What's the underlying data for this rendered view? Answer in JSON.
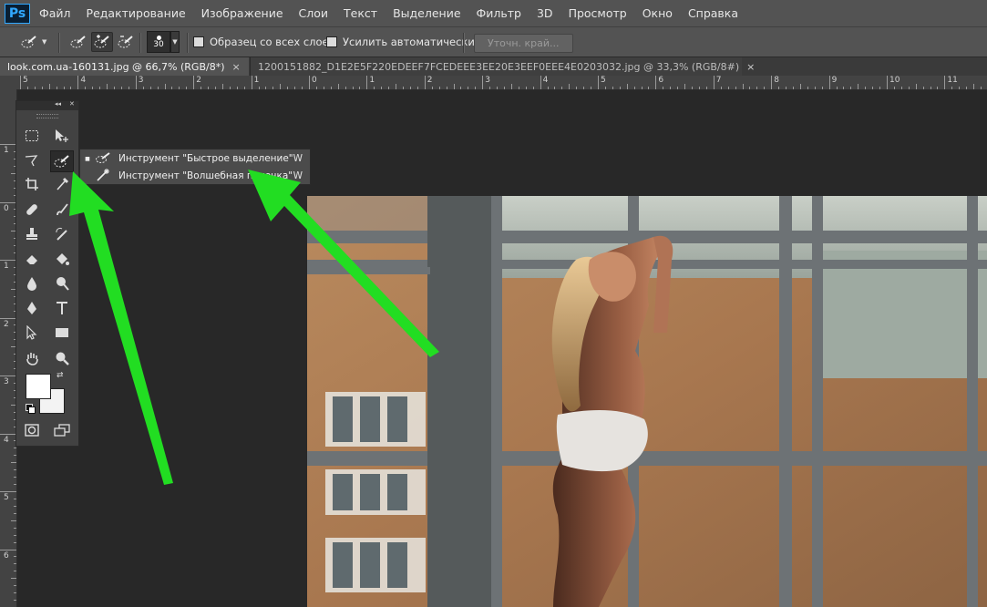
{
  "app": {
    "logo": "Ps"
  },
  "menu": [
    "Файл",
    "Редактирование",
    "Изображение",
    "Слои",
    "Текст",
    "Выделение",
    "Фильтр",
    "3D",
    "Просмотр",
    "Окно",
    "Справка"
  ],
  "options": {
    "brush_size": "30",
    "sample_all_layers": "Образец со всех слоев",
    "auto_enhance": "Усилить автоматически",
    "refine_edge": "Уточн. край..."
  },
  "tabs": [
    {
      "label": "look.com.ua-160131.jpg @ 66,7% (RGB/8*)",
      "close": "×"
    },
    {
      "label": "1200151882_D1E2E5F220EDEEF7FCEDEEE3EE20E3EEF0EEE4E0203032.jpg @ 33,3% (RGB/8#)",
      "close": "×"
    }
  ],
  "ruler_h": [
    "5",
    "4",
    "3",
    "2",
    "1",
    "0",
    "1",
    "2",
    "3",
    "4",
    "5",
    "6",
    "7",
    "8",
    "9",
    "10",
    "11"
  ],
  "ruler_v": [
    "1",
    "0",
    "1",
    "2",
    "3",
    "4",
    "5",
    "6"
  ],
  "toolpanel": {
    "collapse": "◂◂",
    "close": "✕"
  },
  "flyout": [
    {
      "label": "Инструмент \"Быстрое выделение\"",
      "key": "W",
      "bullet": "■"
    },
    {
      "label": "Инструмент \"Волшебная палочка\"",
      "key": "W",
      "bullet": ""
    }
  ],
  "colors": {
    "arrow": "#22dd22",
    "accent": "#31a8ff"
  }
}
